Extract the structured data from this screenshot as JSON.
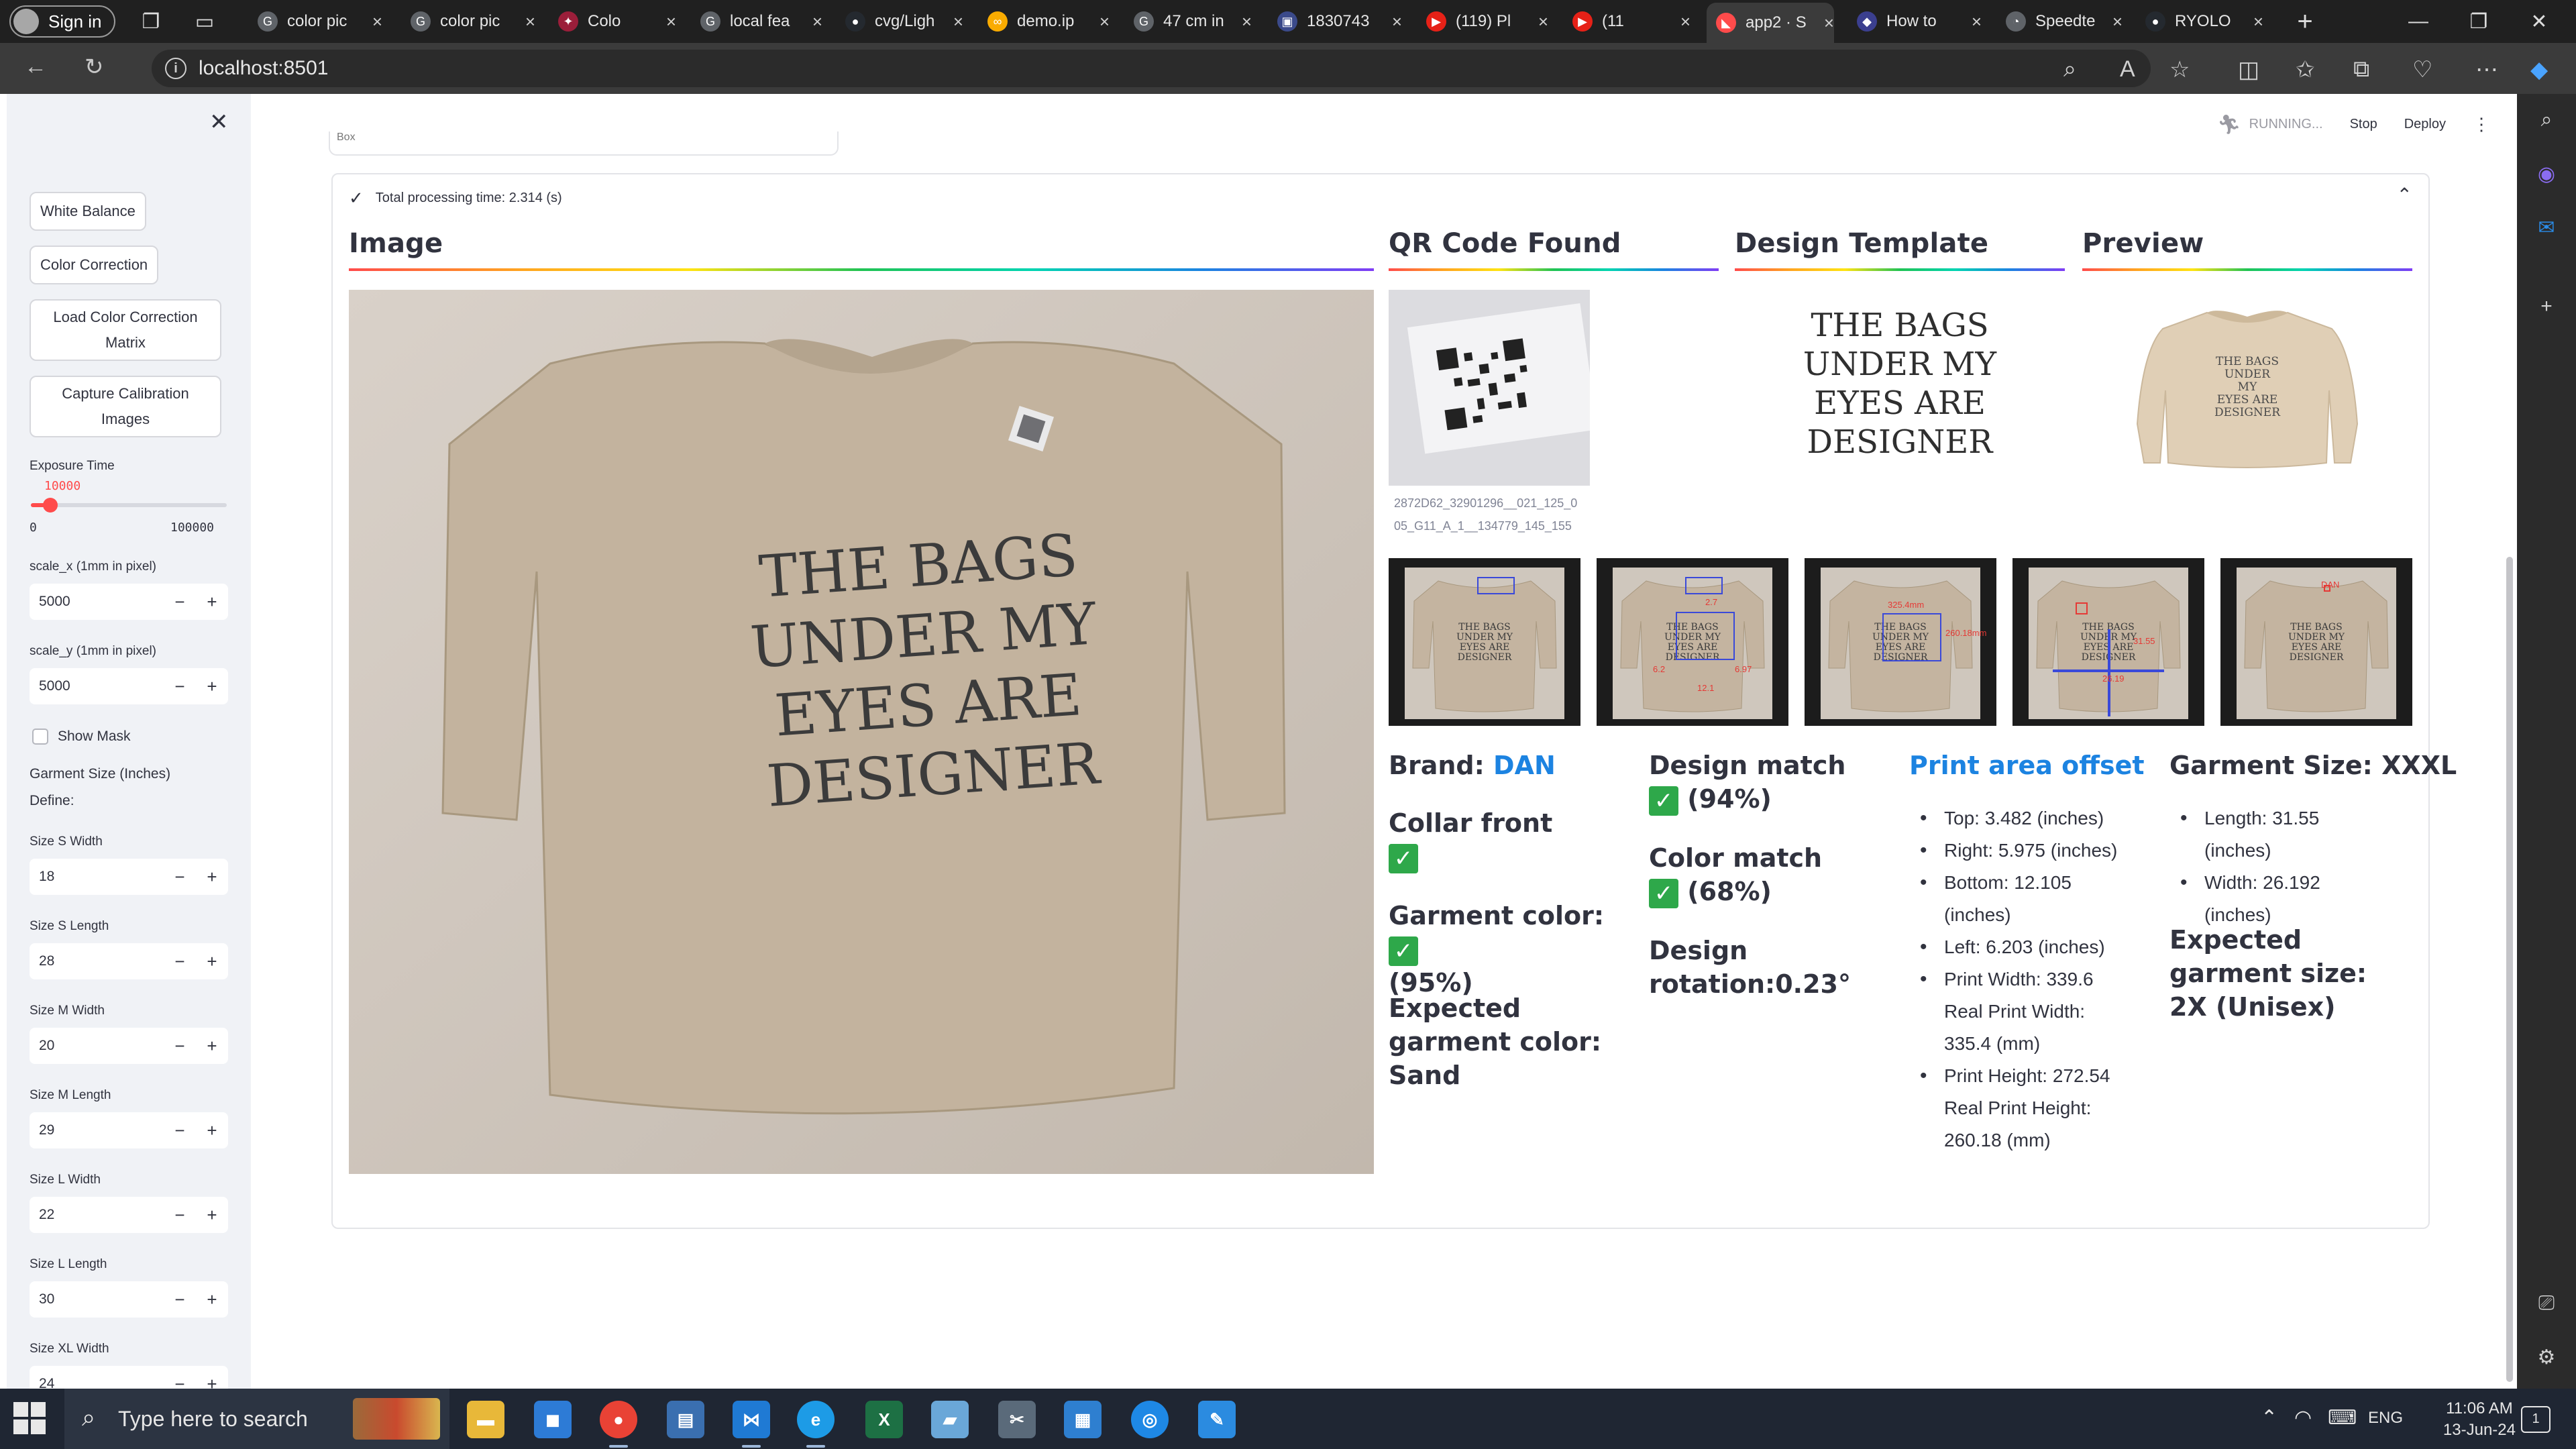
{
  "browser": {
    "signin_label": "Sign in",
    "tabs": [
      {
        "label": "color pic",
        "fav": "google-icon",
        "color": "#5f6368"
      },
      {
        "label": "color pic",
        "fav": "google-icon",
        "color": "#5f6368"
      },
      {
        "label": "Colo",
        "fav": "colour-app-icon",
        "color": "#9b1e3a"
      },
      {
        "label": "local fea",
        "fav": "google-icon",
        "color": "#5f6368"
      },
      {
        "label": "cvg/Ligh",
        "fav": "github-icon",
        "color": "#24292f"
      },
      {
        "label": "demo.ip",
        "fav": "colab-icon",
        "color": "#f9ab00"
      },
      {
        "label": "47 cm in",
        "fav": "google-icon",
        "color": "#5f6368"
      },
      {
        "label": "1830743",
        "fav": "document-icon",
        "color": "#3b4a8a"
      },
      {
        "label": "(119) Pl",
        "fav": "youtube-icon",
        "color": "#e62117"
      },
      {
        "label": "(11",
        "fav": "youtube-icon",
        "color": "#e62117"
      },
      {
        "label": "app2 · S",
        "fav": "streamlit-icon",
        "color": "#ff4b4b"
      },
      {
        "label": "How to",
        "fav": "copilot-icon",
        "color": "#3b3f8f"
      },
      {
        "label": "Speedte",
        "fav": "speedtest-icon",
        "color": "#5f6368"
      },
      {
        "label": "RYOLO",
        "fav": "github-icon",
        "color": "#24292f"
      }
    ],
    "url": "localhost:8501"
  },
  "sidebar": {
    "buttons": {
      "white_balance": "White Balance",
      "color_correction": "Color Correction",
      "load_matrix": "Load Color Correction Matrix",
      "capture_calibration": "Capture Calibration Images"
    },
    "exposure": {
      "label": "Exposure Time",
      "value": "10000",
      "min": "0",
      "max": "100000",
      "fraction": 0.1
    },
    "scale_x": {
      "label": "scale_x (1mm in pixel)",
      "value": "5000"
    },
    "scale_y": {
      "label": "scale_y (1mm in pixel)",
      "value": "5000"
    },
    "show_mask": "Show Mask",
    "garment_size_title": "Garment Size (Inches)",
    "define_label": "Define:",
    "sizes": [
      {
        "label": "Size S Width",
        "value": "18"
      },
      {
        "label": "Size S Length",
        "value": "28"
      },
      {
        "label": "Size M Width",
        "value": "20"
      },
      {
        "label": "Size M Length",
        "value": "29"
      },
      {
        "label": "Size L Width",
        "value": "22"
      },
      {
        "label": "Size L Length",
        "value": "30"
      },
      {
        "label": "Size XL Width",
        "value": "24"
      }
    ]
  },
  "header": {
    "running": "RUNNING...",
    "stop": "Stop",
    "deploy": "Deploy",
    "top_strip": "Box"
  },
  "results": {
    "processing_time": "Total processing time: 2.314 (s)",
    "col_image": "Image",
    "col_qr": "QR Code Found",
    "col_design": "Design Template",
    "col_preview": "Preview",
    "qr_caption": "2872D62_32901296__021_125_005_G11_A_1__134779_145_155",
    "qr_caption_l1": "2872D62_32901296__021_125_0",
    "qr_caption_l2": "05_G11_A_1__134779_145_155",
    "design_text": [
      "THE BAGS",
      "UNDER MY",
      "EYES ARE",
      "DESIGNER"
    ],
    "brand_label": "Brand: ",
    "brand_value": "DAN",
    "collar_front": "Collar front",
    "garment_color": "Garment color:",
    "garment_color_pct": "(95%)",
    "expected_color": "Expected garment color: Sand",
    "design_match": "Design match",
    "design_match_pct": "(94%)",
    "color_match": "Color match",
    "color_match_pct": "(68%)",
    "design_rotation": "Design rotation:0.23°",
    "print_area_title": "Print area offset",
    "print_area": [
      "Top: 3.482 (inches)",
      "Right: 5.975 (inches)",
      "Bottom: 12.105 (inches)",
      "Left: 6.203 (inches)",
      "Print Width: 339.6 Real Print Width: 335.4 (mm)",
      "Print Height: 272.54 Real Print Height: 260.18 (mm)"
    ],
    "garment_size_title": "Garment Size: XXXL",
    "garment_size": [
      "Length: 31.55 (inches)",
      "Width: 26.192 (inches)"
    ],
    "expected_size": "Expected garment size: 2X (Unisex)",
    "thumb_labels": {
      "t2a": "2.7",
      "t2b": "6.2",
      "t2c": "6.97",
      "t2d": "12.1",
      "t3a": "325.4mm",
      "t3b": "260.18mm",
      "t4": "26.19",
      "t4b": "31.55",
      "t5": "DAN"
    }
  },
  "taskbar": {
    "search_placeholder": "Type here to search",
    "lang": "ENG",
    "time": "11:06 AM",
    "date": "13-Jun-24",
    "notifications": "1"
  },
  "colors": {
    "accent": "#ff4b4b",
    "link_blue": "#1c83e1",
    "ok_green": "#2ea84a",
    "sidebar_bg": "#f0f2f6"
  }
}
